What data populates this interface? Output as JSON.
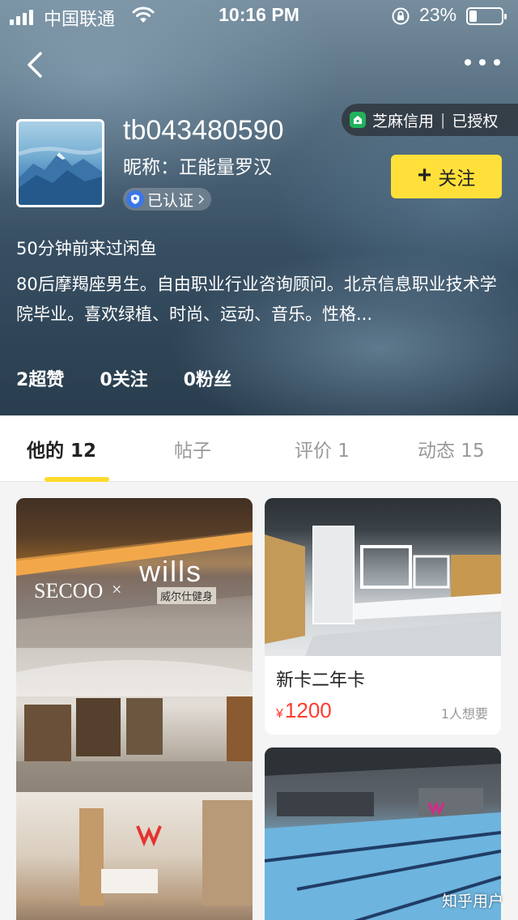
{
  "status_bar": {
    "carrier": "中国联通",
    "time": "10:16 PM",
    "battery_percent": "23%",
    "battery_level": 0.23,
    "icons": [
      "signal-icon",
      "wifi-icon",
      "rotation-lock-icon",
      "battery-icon"
    ]
  },
  "profile": {
    "username": "tb043480590",
    "nickname": "昵称：正能量罗汉",
    "verified_label": "已认证",
    "credit_label": "芝麻信用",
    "credit_status": "已授权",
    "follow_label": "关注",
    "last_seen": "50分钟前来过闲鱼",
    "bio": "80后摩羯座男生。自由职业行业咨询顾问。北京信息职业技术学院毕业。喜欢绿植、时尚、运动、音乐。性格...",
    "stats": [
      {
        "value": "2",
        "label": "超赞"
      },
      {
        "value": "0",
        "label": "关注"
      },
      {
        "value": "0",
        "label": "粉丝"
      }
    ]
  },
  "tabs": [
    {
      "label": "他的 12",
      "active": true
    },
    {
      "label": "帖子",
      "active": false
    },
    {
      "label": "评价 1",
      "active": false
    },
    {
      "label": "动态 15",
      "active": false
    }
  ],
  "feed": {
    "big_card": {
      "photo_text_1": "SECOO",
      "photo_text_2": "×",
      "photo_text_3": "wills",
      "photo_text_4": "威尔仕健身"
    },
    "item": {
      "title": "新卡二年卡",
      "currency": "¥",
      "price": "1200",
      "wants": "1人想要"
    }
  },
  "watermark": "知乎用户",
  "colors": {
    "accent_yellow": "#ffe03a",
    "price_red": "#ff3b30",
    "verified_blue": "#3b76e8",
    "credit_green": "#22b25c"
  }
}
